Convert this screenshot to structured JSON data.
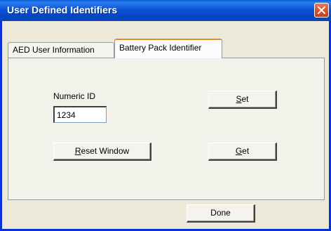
{
  "window": {
    "title": "User Defined Identifiers"
  },
  "tabs": [
    {
      "label": "AED User Information",
      "selected": false
    },
    {
      "label": "Battery Pack Identifier",
      "selected": true
    }
  ],
  "form": {
    "numeric_id_label": "Numeric ID",
    "numeric_id_value": "1234"
  },
  "buttons": {
    "set": {
      "mnemonic": "S",
      "rest": "et"
    },
    "get": {
      "mnemonic": "G",
      "rest": "et"
    },
    "reset": {
      "mnemonic": "R",
      "rest": "eset Window"
    },
    "done": "Done"
  },
  "colors": {
    "titlebar": "#0b54d6",
    "dialog_bg": "#ece9d8",
    "tab_highlight": "#e68b2c",
    "close_button": "#d9532f"
  },
  "icons": {
    "close": "close-icon"
  }
}
